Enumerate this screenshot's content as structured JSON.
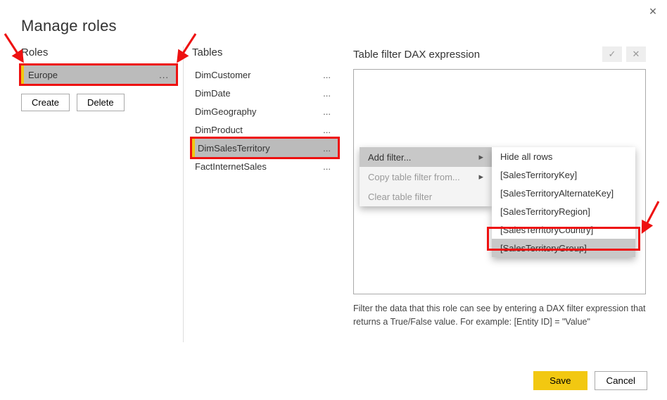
{
  "window": {
    "title": "Manage roles"
  },
  "sections": {
    "roles": "Roles",
    "tables": "Tables",
    "expr": "Table filter DAX expression"
  },
  "roles": {
    "items": [
      {
        "label": "Europe"
      }
    ],
    "create_label": "Create",
    "delete_label": "Delete",
    "selected_index": 0
  },
  "tables": {
    "items": [
      {
        "label": "DimCustomer"
      },
      {
        "label": "DimDate"
      },
      {
        "label": "DimGeography"
      },
      {
        "label": "DimProduct"
      },
      {
        "label": "DimSalesTerritory"
      },
      {
        "label": "FactInternetSales"
      }
    ],
    "selected_index": 4
  },
  "expr": {
    "value": "",
    "help": "Filter the data that this role can see by entering a DAX filter expression that returns a True/False value. For example: [Entity ID] = \"Value\"",
    "check_icon": "✓",
    "x_icon": "✕"
  },
  "context_menu": {
    "items": [
      {
        "label": "Add filter...",
        "has_sub": true,
        "highlight": true
      },
      {
        "label": "Copy table filter from...",
        "has_sub": true,
        "disabled": true
      },
      {
        "label": "Clear table filter",
        "disabled": true
      }
    ]
  },
  "submenu": {
    "items": [
      {
        "label": "Hide all rows"
      },
      {
        "label": "[SalesTerritoryKey]"
      },
      {
        "label": "[SalesTerritoryAlternateKey]"
      },
      {
        "label": "[SalesTerritoryRegion]"
      },
      {
        "label": "[SalesTerritoryCountry]"
      },
      {
        "label": "[SalesTerritoryGroup]",
        "highlight": true
      }
    ]
  },
  "footer": {
    "save_label": "Save",
    "cancel_label": "Cancel"
  }
}
